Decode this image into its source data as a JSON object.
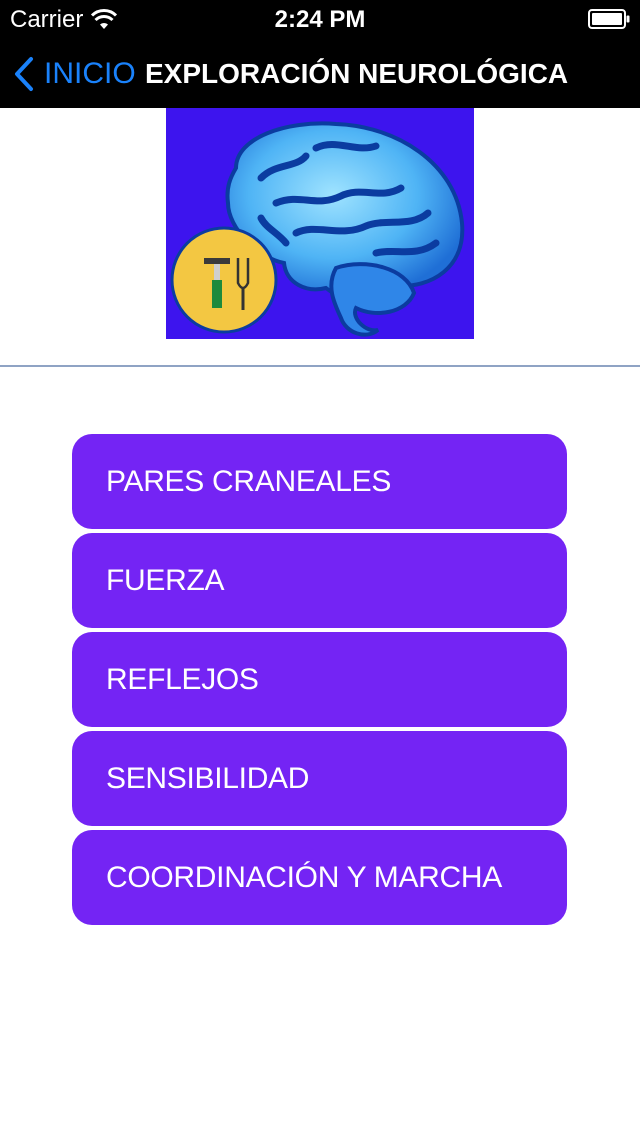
{
  "status_bar": {
    "carrier": "Carrier",
    "time": "2:24 PM"
  },
  "nav": {
    "back_label": "INICIO",
    "title": "EXPLORACIÓN NEUROLÓGICA"
  },
  "logo": {
    "icon": "brain-with-reflex-hammer-and-tuning-fork"
  },
  "menu": {
    "items": [
      {
        "label": "PARES CRANEALES"
      },
      {
        "label": "FUERZA"
      },
      {
        "label": "REFLEJOS"
      },
      {
        "label": "SENSIBILIDAD"
      },
      {
        "label": "COORDINACIÓN Y MARCHA"
      }
    ]
  },
  "colors": {
    "bar_background": "#000000",
    "back_link": "#1a82fb",
    "button_fill": "#7424f4",
    "logo_background": "#3d14ee"
  }
}
